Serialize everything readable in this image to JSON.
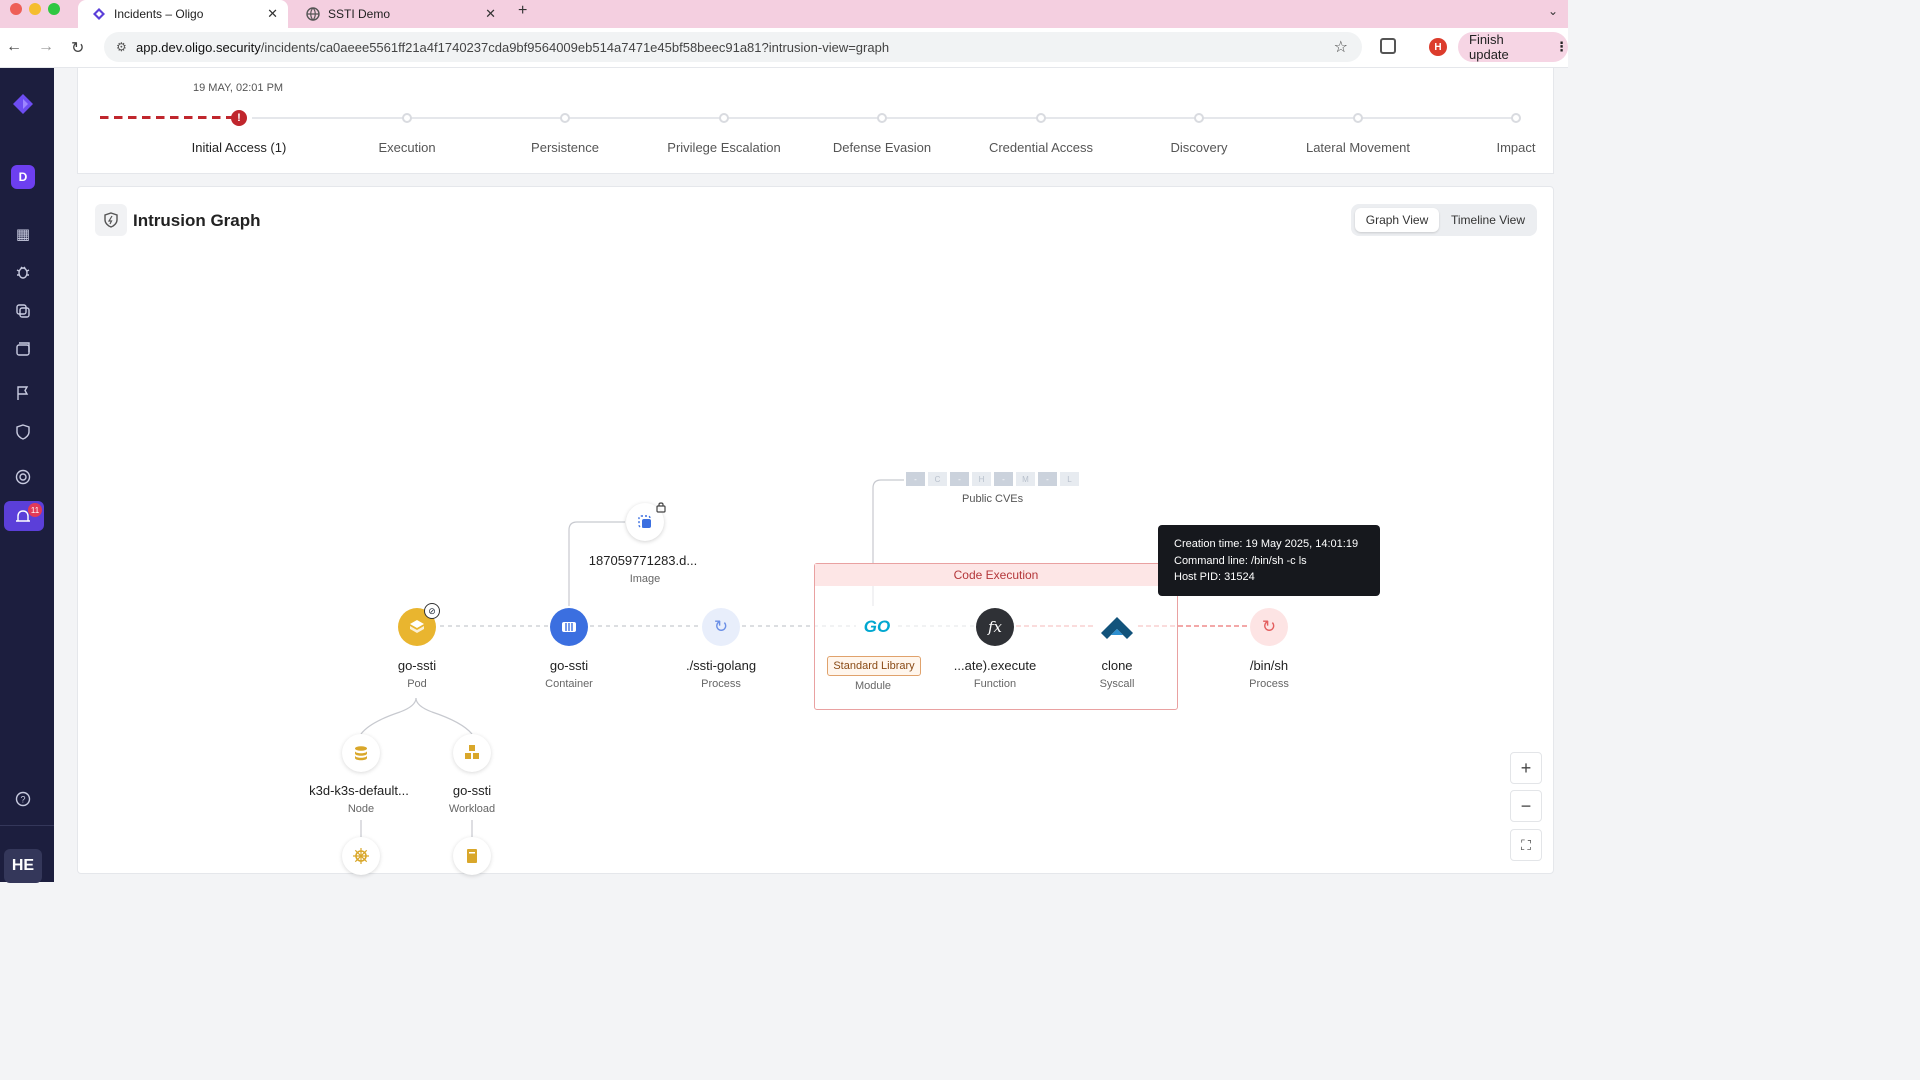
{
  "browser": {
    "tabs": [
      {
        "title": "Incidents – Oligo",
        "active": true,
        "favicon": "oligo-logo-icon"
      },
      {
        "title": "SSTI Demo",
        "active": false,
        "favicon": "globe-icon"
      }
    ],
    "url_host": "app.dev.oligo.security",
    "url_path": "/incidents/ca0aeee5561ff21a4f1740237cda9bf9564009eb514a7471e45bf58beec91a81?intrusion-view=graph",
    "profile_initial": "H",
    "finish_update_label": "Finish update"
  },
  "sidebar": {
    "avatar_letter": "D",
    "alerts_badge": "11",
    "footer_label": "HE",
    "icons": [
      "grid-icon",
      "bug-icon",
      "copy-icon",
      "folder-icon",
      "flag-icon",
      "shield-icon",
      "target-icon",
      "alarm-icon",
      "help-icon"
    ]
  },
  "mitre": {
    "date": "19 MAY, 02:01 PM",
    "stages": [
      "Initial Access (1)",
      "Execution",
      "Persistence",
      "Privilege Escalation",
      "Defense Evasion",
      "Credential Access",
      "Discovery",
      "Lateral Movement",
      "Impact"
    ],
    "active_stage_index": 0,
    "alert_color": "#c0262d"
  },
  "graph": {
    "title": "Intrusion Graph",
    "view_toggle": {
      "graph": "Graph View",
      "timeline": "Timeline View",
      "selected": "graph"
    },
    "nodes": {
      "pod": {
        "label": "go-ssti",
        "type": "Pod"
      },
      "container": {
        "label": "go-ssti",
        "type": "Container"
      },
      "image": {
        "label": "187059771283.d...",
        "type": "Image"
      },
      "process1": {
        "label": "./ssti-golang",
        "type": "Process"
      },
      "module": {
        "label": "Standard Library",
        "type": "Module",
        "logo": "GO"
      },
      "function": {
        "label": "...ate).execute",
        "type": "Function",
        "symbol": "fx"
      },
      "syscall": {
        "label": "clone",
        "type": "Syscall"
      },
      "process2": {
        "label": "/bin/sh",
        "type": "Process"
      },
      "node": {
        "label": "k3d-k3s-default...",
        "type": "Node"
      },
      "workload": {
        "label": "go-ssti",
        "type": "Workload"
      }
    },
    "code_execution_label": "Code Execution",
    "public_cves": {
      "label": "Public CVEs",
      "chips": [
        {
          "count": "-",
          "severity": "C"
        },
        {
          "count": "-",
          "severity": "H"
        },
        {
          "count": "-",
          "severity": "M"
        },
        {
          "count": "-",
          "severity": "L"
        }
      ]
    },
    "tooltip": {
      "line1": "Creation time: 19 May 2025, 14:01:19",
      "line2": "Command line: /bin/sh -c ls",
      "line3": "Host PID: 31524"
    },
    "zoom": {
      "in": "+",
      "out": "−",
      "fit": "⛶"
    }
  },
  "colors": {
    "sidebar_bg": "#1c1e3e",
    "accent_purple": "#6d3ff0",
    "pod_yellow": "#e9b52f",
    "container_blue": "#3b6fe0",
    "alert_red": "#e35d5d"
  }
}
